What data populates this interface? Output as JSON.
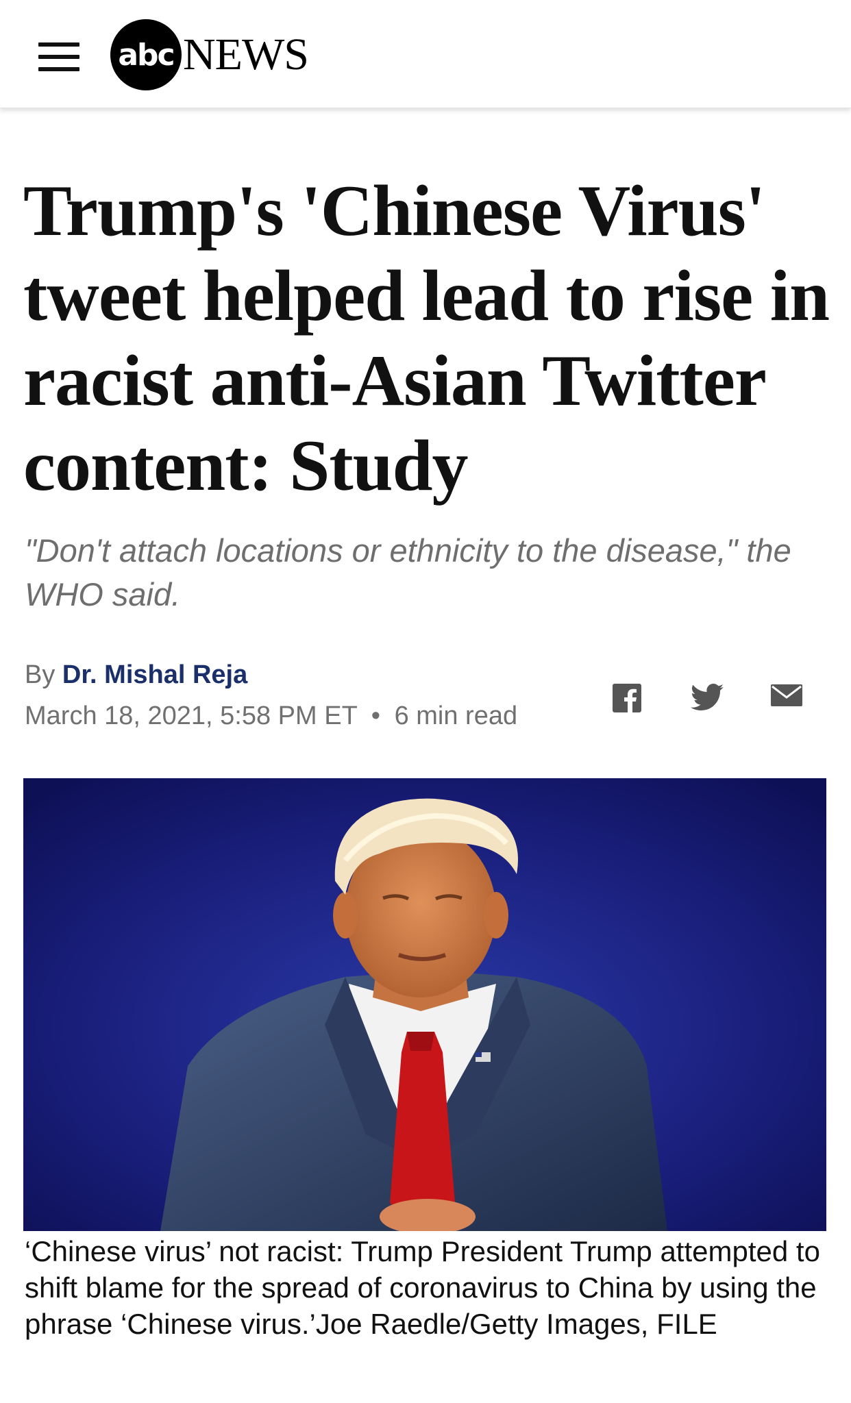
{
  "header": {
    "menu_icon": "hamburger-menu-icon",
    "logo_abc": "abc",
    "logo_news": "NEWS"
  },
  "article": {
    "headline": "Trump's 'Chinese Virus' tweet helped lead to rise in racist anti-Asian Twitter content: Study",
    "subheadline": "\"Don't attach locations or ethnicity to the disease,\" the WHO said.",
    "byline_prefix": "By",
    "author": "Dr. Mishal Reja",
    "date": "March 18, 2021, 5:58 PM ET",
    "separator": "•",
    "read_time": "6 min read",
    "share": {
      "facebook_icon": "facebook-icon",
      "twitter_icon": "twitter-icon",
      "email_icon": "email-icon"
    },
    "image": {
      "subject": "Man in navy suit and red tie on stage against blue background"
    },
    "caption": "‘Chinese virus’ not racist: Trump President Trump attempted to shift blame for the spread of coronavirus to China by using the phrase ‘Chinese virus.’Joe Raedle/Getty Images, FILE"
  },
  "colors": {
    "author_link": "#1b2f6b",
    "meta_gray": "#6e6e6e",
    "image_background": "#15186a",
    "tie_red": "#c8151a"
  }
}
